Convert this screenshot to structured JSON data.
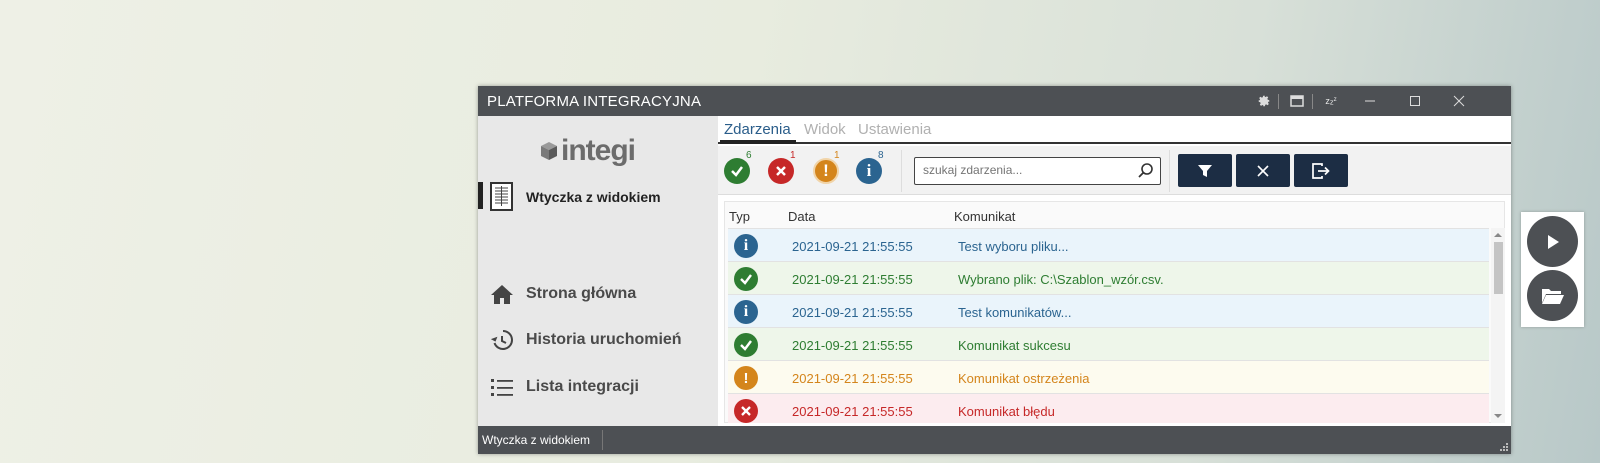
{
  "window": {
    "title": "PLATFORMA INTEGRACYJNA"
  },
  "sidebar": {
    "logo_text": "integi",
    "plugin_label": "Wtyczka z widokiem",
    "nav": [
      {
        "label": "Strona główna",
        "icon": "home-icon"
      },
      {
        "label": "Historia uruchomień",
        "icon": "history-icon"
      },
      {
        "label": "Lista integracji",
        "icon": "list-icon"
      }
    ]
  },
  "tabs": [
    "Zdarzenia",
    "Widok",
    "Ustawienia"
  ],
  "counts": {
    "success": "6",
    "error": "1",
    "warning": "1",
    "info": "8"
  },
  "search": {
    "placeholder": "szukaj zdarzenia..."
  },
  "table": {
    "headers": [
      "Typ",
      "Data",
      "Komunikat"
    ],
    "rows": [
      {
        "type": "info",
        "date": "2021-09-21 21:55:55",
        "message": "Test wyboru pliku..."
      },
      {
        "type": "success",
        "date": "2021-09-21 21:55:55",
        "message": "Wybrano plik: C:\\Szablon_wzór.csv."
      },
      {
        "type": "info",
        "date": "2021-09-21 21:55:55",
        "message": "Test komunikatów..."
      },
      {
        "type": "success",
        "date": "2021-09-21 21:55:55",
        "message": "Komunikat sukcesu"
      },
      {
        "type": "warning",
        "date": "2021-09-21 21:55:55",
        "message": "Komunikat ostrzeżenia"
      },
      {
        "type": "error",
        "date": "2021-09-21 21:55:55",
        "message": "Komunikat błędu"
      }
    ]
  },
  "statusbar": {
    "text": "Wtyczka z widokiem"
  },
  "colors": {
    "titlebar": "#4d5054",
    "success": "#2e7d32",
    "error": "#c62828",
    "warning": "#d4851c",
    "info": "#2b6490",
    "action_button": "#1c2d44"
  }
}
